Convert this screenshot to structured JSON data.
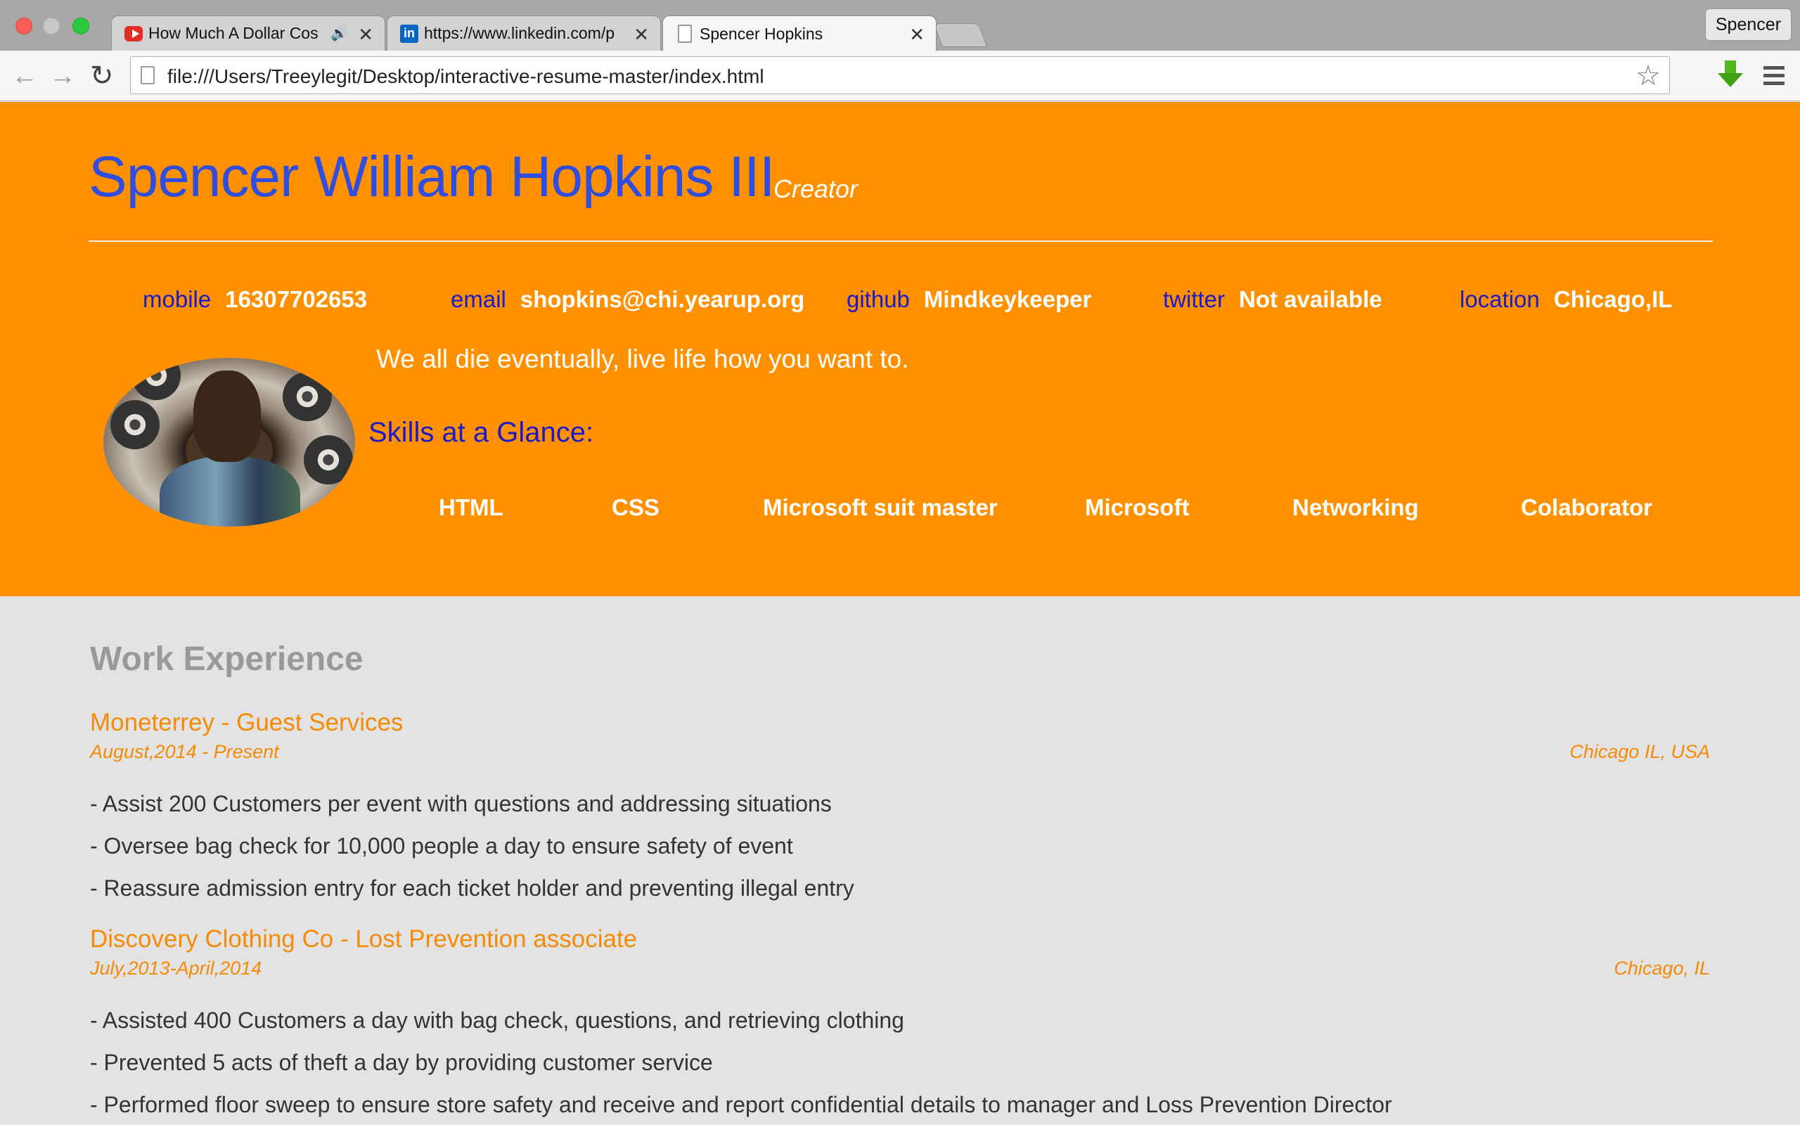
{
  "browser": {
    "tabs": [
      {
        "title": "How Much A Dollar Cos",
        "icon": "youtube-icon"
      },
      {
        "title": "https://www.linkedin.com/p",
        "icon": "linkedin-icon"
      },
      {
        "title": "Spencer Hopkins",
        "icon": "document-icon"
      }
    ],
    "profile_name": "Spencer",
    "url": "file:///Users/Treeylegit/Desktop/interactive-resume-master/index.html"
  },
  "header": {
    "name": "Spencer William Hopkins III",
    "role": "Creator",
    "contacts": [
      {
        "label": "mobile",
        "value": "16307702653"
      },
      {
        "label": "email",
        "value": "shopkins@chi.yearup.org"
      },
      {
        "label": "github",
        "value": "Mindkeykeeper"
      },
      {
        "label": "twitter",
        "value": "Not available"
      },
      {
        "label": "location",
        "value": "Chicago,IL"
      }
    ],
    "motto": "We all die eventually, live life how you want to.",
    "skills_title": "Skills at a Glance:",
    "skills": [
      "HTML",
      "CSS",
      "Microsoft suit master",
      "Microsoft",
      "Networking",
      "Colaborator"
    ]
  },
  "work": {
    "title": "Work Experience",
    "jobs": [
      {
        "title": "Moneterrey - Guest Services",
        "dates": "August,2014 - Present",
        "location": "Chicago IL, USA",
        "bullets": [
          "- Assist 200 Customers per event with questions and addressing situations",
          "- Oversee bag check for 10,000 people a day to ensure safety of event",
          "- Reassure admission entry for each ticket holder and preventing illegal entry"
        ]
      },
      {
        "title": "Discovery Clothing Co - Lost Prevention associate",
        "dates": "July,2013-April,2014",
        "location": "Chicago, IL",
        "bullets": [
          "- Assisted 400 Customers a day with bag check, questions, and retrieving clothing",
          "- Prevented 5 acts of theft a day by providing customer service",
          "- Performed floor sweep to ensure store safety and receive and report confidential details to manager and Loss Prevention Director"
        ]
      }
    ]
  },
  "colors": {
    "header_bg": "#ff9100",
    "name": "#2f4de0",
    "label": "#1a1ac8",
    "accent": "#f58a07",
    "page_bg": "#e3e3e3"
  }
}
